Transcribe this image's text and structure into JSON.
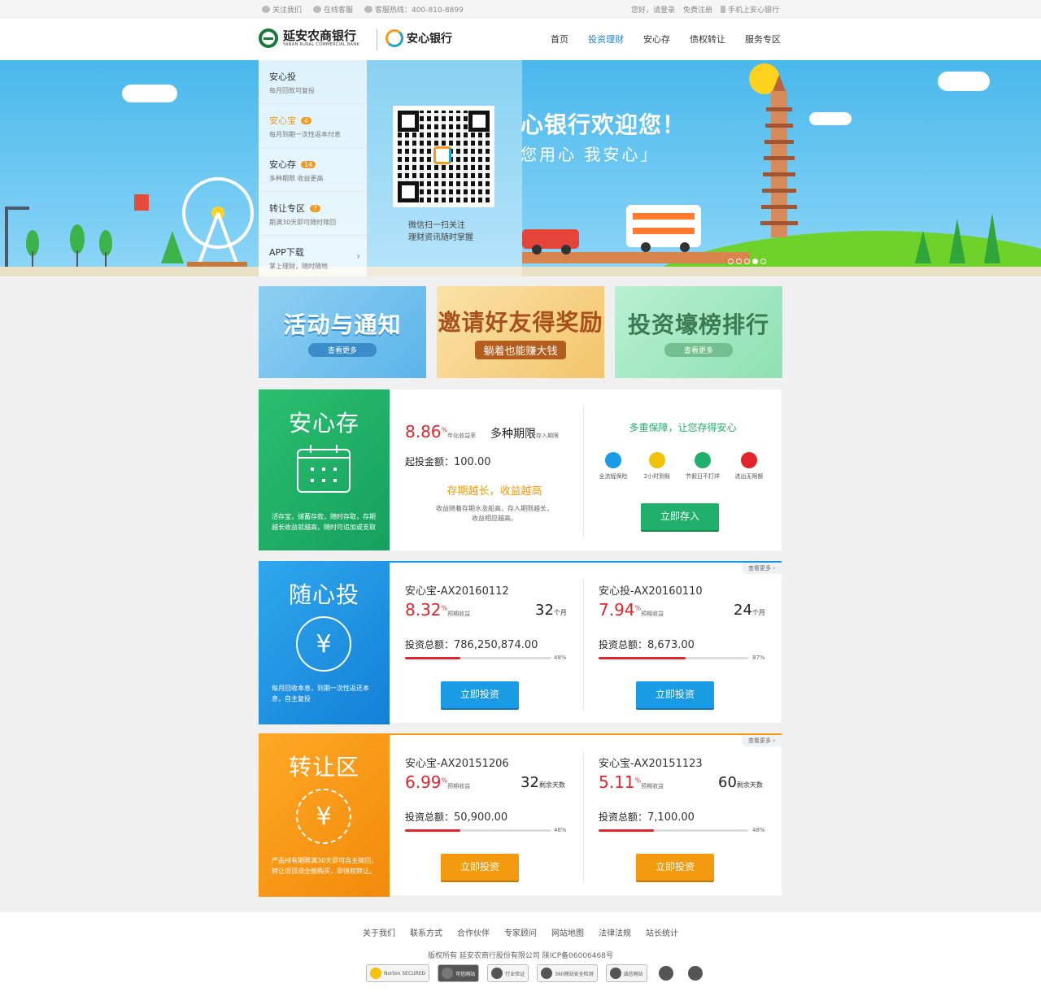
{
  "topbar": {
    "follow": "关注我们",
    "online_service": "在线客服",
    "hotline": "客服热线：400-810-8899",
    "greeting": "您好，请登录",
    "register": "免费注册",
    "mobile": "手机上安心银行"
  },
  "header": {
    "logo1_cn": "延安农商银行",
    "logo1_en": "YANAN RURAL COMMERCIAL BANK",
    "logo2": "安心银行",
    "nav": [
      "首页",
      "投资理财",
      "安心存",
      "债权转让",
      "服务专区"
    ],
    "active_nav": "投资理财"
  },
  "banner": {
    "menu": [
      {
        "name": "安心投",
        "desc": "每月回款可复投",
        "badge": ""
      },
      {
        "name": "安心宝",
        "desc": "每月到期一次性返本付息",
        "badge": "4"
      },
      {
        "name": "安心存",
        "desc": "多种期限  收益更高",
        "badge": "14"
      },
      {
        "name": "转让专区",
        "desc": "期满30天即可随时赎回",
        "badge": "7"
      },
      {
        "name": "APP下载",
        "desc": "掌上理财，随时随地",
        "badge": ""
      }
    ],
    "qr_line1": "微信扫一扫关注",
    "qr_line2": "理财资讯随时掌握",
    "welcome": "心银行欢迎您！",
    "slogan": "您用心  我安心」",
    "slide_count": 5,
    "active_slide": 4
  },
  "promos": [
    {
      "title": "活动与通知",
      "button": "查看更多"
    },
    {
      "title": "邀请好友得奖励",
      "button": "躺着也能赚大钱"
    },
    {
      "title": "投资壕榜排行",
      "button": "查看更多"
    }
  ],
  "anxincun": {
    "title": "安心存",
    "desc": "活存宝，储蓄存款，随时存取，存期越长收益就越高，随时可追加或支取",
    "rate": "8.86",
    "rate_unit": "%",
    "rate_label": "年化收益率",
    "term": "多种期限",
    "term_label": "存入期限",
    "min_label": "起投金额：",
    "min_amount": "100.00",
    "highlight": "存期越长，收益越高",
    "note1": "收益随着存期水涨船高，存入期限越长，",
    "note2": "收益相应越高。",
    "guarantee": "多重保障，让您存得安心",
    "features": [
      "全流程保险",
      "2小时到账",
      "节假日不打烊",
      "进出无限额"
    ],
    "button": "立即存入"
  },
  "suixintou": {
    "title": "随心投",
    "desc": "每月回收本息，到期一次性返还本息，自主复投",
    "more": "查看更多 ›",
    "items": [
      {
        "name": "安心宝-AX20160112",
        "rate": "8.32",
        "rate_label": "预期收益",
        "term": "32",
        "term_unit": "个月",
        "total_label": "投资总额：",
        "total": "786,250,874.00",
        "progress": "48%",
        "button": "立即投资"
      },
      {
        "name": "安心投-AX20160110",
        "rate": "7.94",
        "rate_label": "预期收益",
        "term": "24",
        "term_unit": "个月",
        "total_label": "投资总额：",
        "total": "8,673.00",
        "progress": "87%",
        "button": "立即投资"
      }
    ]
  },
  "zhuanrang": {
    "title": "转让区",
    "desc": "产品持有期限满30天即可自主赎回，转让项目须全额购买，即债权转让。",
    "more": "查看更多 ›",
    "items": [
      {
        "name": "安心宝-AX20151206",
        "rate": "6.99",
        "rate_label": "预期收益",
        "term": "32",
        "term_unit": "剩余天数",
        "total_label": "投资总额：",
        "total": "50,900.00",
        "progress": "48%",
        "button": "立即投资"
      },
      {
        "name": "安心宝-AX20151123",
        "rate": "5.11",
        "rate_label": "预期收益",
        "term": "60",
        "term_unit": "剩余天数",
        "total_label": "投资总额：",
        "total": "7,100.00",
        "progress": "48%",
        "button": "立即投资"
      }
    ]
  },
  "footer": {
    "links": [
      "关于我们",
      "联系方式",
      "合作伙伴",
      "专家顾问",
      "网站地图",
      "法律法规",
      "站长统计"
    ],
    "copyright": "版权所有  延安农商行股份有限公司  陕ICP备06006468号",
    "badges": [
      "Norton SECURED",
      "可信网站",
      "行业验证",
      "360网站安全检测",
      "诚信网站",
      "",
      ""
    ]
  },
  "colors": {
    "green": "#20b06b",
    "blue": "#1a9be6",
    "orange": "#f39a0f",
    "red": "#e3242b",
    "nav_active": "#1d84d8"
  }
}
